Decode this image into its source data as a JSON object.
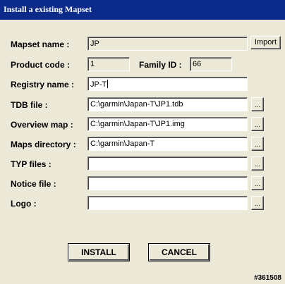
{
  "window": {
    "title": "Install a existing Mapset"
  },
  "form": {
    "mapset_name": {
      "label": "Mapset name :",
      "value": "JP"
    },
    "import_button": "Import",
    "product_code": {
      "label": "Product code :",
      "value": "1"
    },
    "family_id": {
      "label": "Family ID :",
      "value": "66"
    },
    "registry_name": {
      "label": "Registry name :",
      "value": "JP-T"
    },
    "tdb_file": {
      "label": "TDB file :",
      "value": "C:\\garmin\\Japan-T\\JP1.tdb"
    },
    "overview_map": {
      "label": "Overview map :",
      "value": "C:\\garmin\\Japan-T\\JP1.img"
    },
    "maps_directory": {
      "label": "Maps directory :",
      "value": "C:\\garmin\\Japan-T"
    },
    "typ_files": {
      "label": "TYP files :",
      "value": ""
    },
    "notice_file": {
      "label": "Notice file :",
      "value": ""
    },
    "logo": {
      "label": "Logo :",
      "value": ""
    },
    "browse_label": "..."
  },
  "actions": {
    "install": "INSTALL",
    "cancel": "CANCEL"
  },
  "watermark": "#361508",
  "colors": {
    "titlebar": "#0b2a8a",
    "dialog_bg": "#ece9d8"
  }
}
